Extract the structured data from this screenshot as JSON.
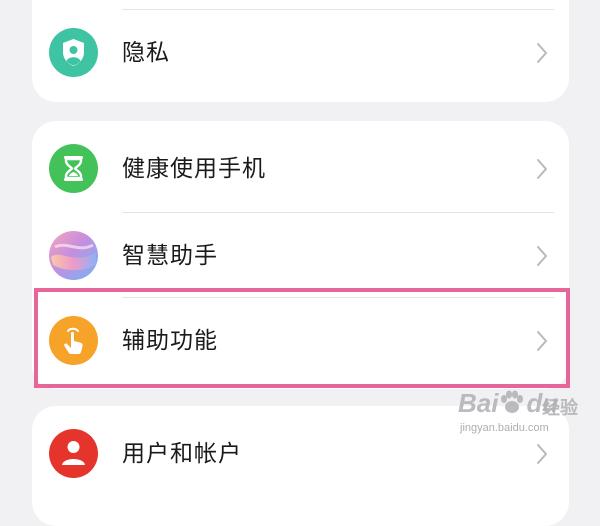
{
  "settings": {
    "card1": {
      "items": [
        {
          "label": "隐私",
          "icon": "shield-person-icon",
          "icon_color": "#3fc4a3"
        }
      ]
    },
    "card2": {
      "items": [
        {
          "label": "健康使用手机",
          "icon": "hourglass-icon",
          "icon_color": "#44c25a"
        },
        {
          "label": "智慧助手",
          "icon": "gradient-orb-icon",
          "icon_color": "#c590d8"
        },
        {
          "label": "辅助功能",
          "icon": "hand-tap-icon",
          "icon_color": "#f7a228"
        }
      ]
    },
    "card3": {
      "items": [
        {
          "label": "用户和帐户",
          "icon": "user-icon",
          "icon_color": "#e5342b"
        }
      ]
    }
  },
  "highlight_color": "#e6669a",
  "watermark": {
    "logo": "Bai",
    "logo_tail": "du",
    "suffix": "经验",
    "url": "jingyan.baidu.com"
  }
}
